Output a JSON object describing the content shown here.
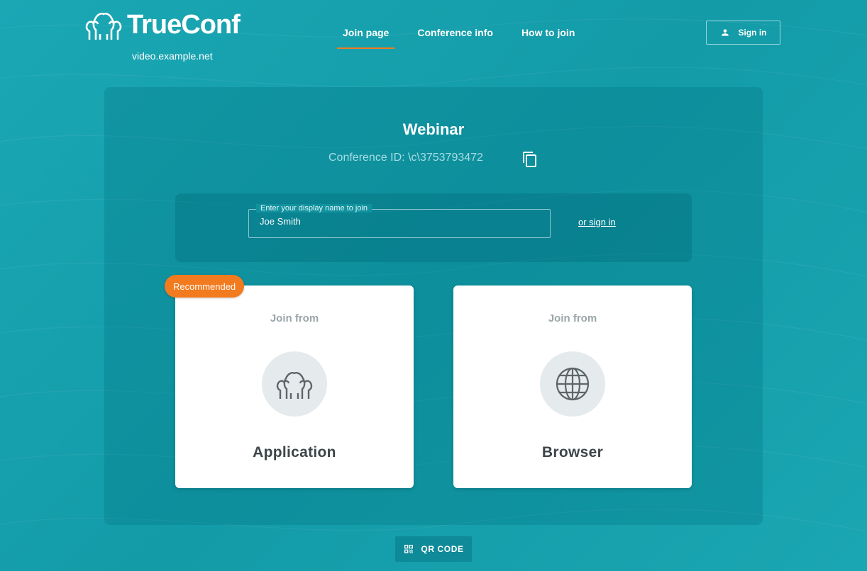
{
  "header": {
    "brand": "TrueConf",
    "server": "video.example.net",
    "nav": [
      {
        "label": "Join page",
        "active": true
      },
      {
        "label": "Conference info",
        "active": false
      },
      {
        "label": "How to join",
        "active": false
      }
    ],
    "sign_in_label": "Sign in",
    "sign_in_icon": "person-icon"
  },
  "conference": {
    "title": "Webinar",
    "id_text": "Conference ID: \\c\\3753793472",
    "copy_icon": "copy-icon"
  },
  "join_form": {
    "name_label": "Enter your display name to join",
    "name_value": "Joe Smith",
    "or_sign_in": "or sign in"
  },
  "options": [
    {
      "subtitle": "Join from",
      "title": "Application",
      "icon": "people-icon",
      "badge": "Recommended"
    },
    {
      "subtitle": "Join from",
      "title": "Browser",
      "icon": "globe-icon"
    }
  ],
  "qr_label": "QR CODE",
  "colors": {
    "background": "#17a2af",
    "accent": "#f27b1f",
    "card": "#ffffff",
    "card_text": "#3d4548"
  }
}
